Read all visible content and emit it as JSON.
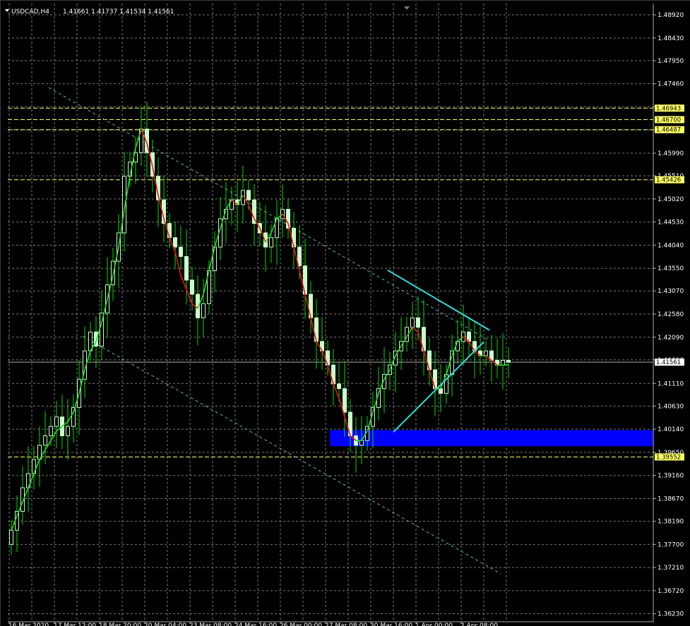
{
  "header": {
    "symbol_timeframe": "USDCAD,H4",
    "ohlc": "1.41661 1.41737 1.41534 1.41561"
  },
  "colors": {
    "background": "#000000",
    "grid": "#7a7a7a",
    "bull_candle": "#c8ffc8",
    "bear_candle": "#c8ffc8",
    "wick": "#00dd00",
    "ma_up": "#22dd22",
    "ma_down": "#ee1111",
    "trendline": "#33dddd",
    "channel": "#55bbbb",
    "zone": "#0000ff",
    "level_line": "#ffff66",
    "level_tag": "#ffff66",
    "current_tag": "#ffffff"
  },
  "chart_data": {
    "type": "candlestick",
    "symbol": "USDCAD",
    "timeframe": "H4",
    "ylim": [
      1.3606,
      1.4916
    ],
    "y_ticks": [
      1.4892,
      1.4843,
      1.4795,
      1.4746,
      1.4697,
      1.4648,
      1.4599,
      1.4551,
      1.4502,
      1.4453,
      1.4404,
      1.4355,
      1.4307,
      1.4258,
      1.4209,
      1.4161,
      1.4111,
      1.4063,
      1.4014,
      1.3965,
      1.3916,
      1.3867,
      1.3819,
      1.377,
      1.3721,
      1.3672,
      1.3623
    ],
    "y_tick_labels": [
      "1.48920",
      "1.48430",
      "1.47950",
      "1.47460",
      "1.46970",
      "1.46480",
      "1.45990",
      "1.45510",
      "1.45020",
      "1.44530",
      "1.44040",
      "1.43550",
      "1.43070",
      "1.42580",
      "1.42090",
      "1.41610",
      "1.41110",
      "1.40630",
      "1.40140",
      "1.39650",
      "1.39160",
      "1.38670",
      "1.38190",
      "1.37700",
      "1.37210",
      "1.36720",
      "1.36230"
    ],
    "x_labels": [
      "16 Mar 2020",
      "17 Mar 12:00",
      "18 Mar 20:00",
      "20 Mar 04:00",
      "23 Mar 08:00",
      "24 Mar 16:00",
      "26 Mar 00:00",
      "27 Mar 08:00",
      "30 Mar 16:00",
      "1 Apr 00:00",
      "2 Apr 08:00"
    ],
    "x_label_bars": [
      0,
      8,
      16,
      24,
      32,
      40,
      48,
      56,
      64,
      72,
      80
    ],
    "bar_count": 89,
    "close": [
      1.38,
      1.384,
      1.389,
      1.392,
      1.395,
      1.398,
      1.4,
      1.402,
      1.404,
      1.4,
      1.402,
      1.406,
      1.412,
      1.418,
      1.422,
      1.419,
      1.426,
      1.432,
      1.437,
      1.443,
      1.455,
      1.458,
      1.46,
      1.465,
      1.46,
      1.455,
      1.45,
      1.445,
      1.442,
      1.44,
      1.438,
      1.433,
      1.43,
      1.425,
      1.428,
      1.435,
      1.44,
      1.446,
      1.448,
      1.45,
      1.449,
      1.452,
      1.45,
      1.445,
      1.443,
      1.44,
      1.442,
      1.446,
      1.448,
      1.444,
      1.44,
      1.436,
      1.43,
      1.425,
      1.42,
      1.418,
      1.415,
      1.411,
      1.41,
      1.405,
      1.4,
      1.398,
      1.399,
      1.402,
      1.406,
      1.41,
      1.413,
      1.415,
      1.418,
      1.42,
      1.423,
      1.425,
      1.423,
      1.418,
      1.414,
      1.41,
      1.409,
      1.413,
      1.418,
      1.42,
      1.422,
      1.42,
      1.418,
      1.417,
      1.418,
      1.416,
      1.415,
      1.416,
      1.4156
    ],
    "moving_average": [
      1.38,
      1.383,
      1.386,
      1.389,
      1.392,
      1.395,
      1.397,
      1.399,
      1.401,
      1.402,
      1.403,
      1.405,
      1.409,
      1.414,
      1.418,
      1.42,
      1.424,
      1.429,
      1.434,
      1.44,
      1.448,
      1.455,
      1.461,
      1.465,
      1.462,
      1.457,
      1.451,
      1.446,
      1.442,
      1.439,
      1.434,
      1.431,
      1.428,
      1.427,
      1.43,
      1.435,
      1.44,
      1.444,
      1.448,
      1.45,
      1.449,
      1.451,
      1.449,
      1.446,
      1.444,
      1.441,
      1.443,
      1.446,
      1.447,
      1.445,
      1.44,
      1.435,
      1.43,
      1.425,
      1.42,
      1.418,
      1.415,
      1.411,
      1.408,
      1.404,
      1.4,
      1.399,
      1.399,
      1.401,
      1.405,
      1.409,
      1.412,
      1.414,
      1.417,
      1.419,
      1.421,
      1.423,
      1.422,
      1.418,
      1.414,
      1.41,
      1.41,
      1.413,
      1.417,
      1.42,
      1.421,
      1.42,
      1.418,
      1.417,
      1.417,
      1.416,
      1.415,
      1.415,
      1.415
    ],
    "horizontal_levels": [
      {
        "value": 1.46943,
        "label": "1.46943"
      },
      {
        "value": 1.467,
        "label": "1.46700"
      },
      {
        "value": 1.46487,
        "label": "1.46487"
      },
      {
        "value": 1.45426,
        "label": "1.45426"
      },
      {
        "value": 1.39552,
        "label": "1.39552"
      }
    ],
    "current_price": {
      "value": 1.41561,
      "label": "1.41561"
    },
    "zone": {
      "from_bar": 57,
      "to_bar": 89,
      "top": 1.4012,
      "bottom": 1.3978
    },
    "triangle": {
      "upper": [
        {
          "bar": 67,
          "price": 1.4351
        },
        {
          "bar": 85,
          "price": 1.4224
        }
      ],
      "lower": [
        {
          "bar": 68,
          "price": 1.4008
        },
        {
          "bar": 84,
          "price": 1.4199
        }
      ]
    },
    "channel": {
      "upper": [
        {
          "bar": 7,
          "price": 1.4738
        },
        {
          "bar": 85,
          "price": 1.4202
        }
      ],
      "lower": [
        {
          "bar": 13,
          "price": 1.4211
        },
        {
          "bar": 87,
          "price": 1.3708
        }
      ]
    }
  }
}
